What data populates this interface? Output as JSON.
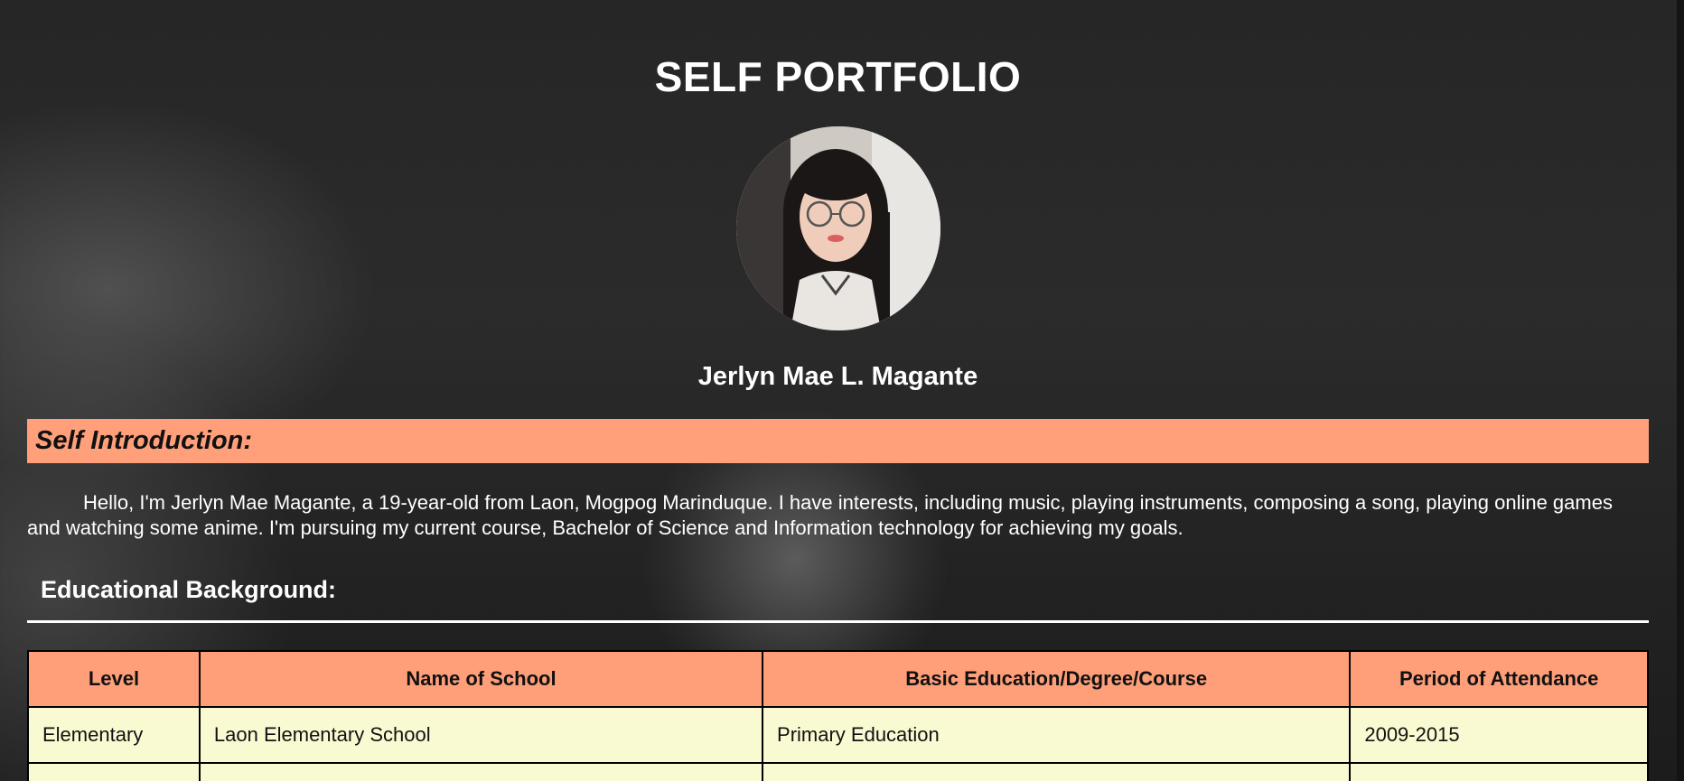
{
  "header": {
    "title": "SELF PORTFOLIO"
  },
  "profile": {
    "photo_icon": "profile-photo",
    "name": "Jerlyn Mae L. Magante"
  },
  "introduction": {
    "heading": "Self Introduction:",
    "body": "Hello, I'm Jerlyn Mae Magante, a 19-year-old from Laon, Mogpog Marinduque. I have interests, including music, playing instruments, composing a song, playing online games and watching some anime. I'm pursuing my current course, Bachelor of Science and Information technology for achieving my goals."
  },
  "education": {
    "heading": "Educational Background:",
    "columns": [
      "Level",
      "Name of School",
      "Basic Education/Degree/Course",
      "Period of Attendance"
    ],
    "rows": [
      [
        "Elementary",
        "Laon Elementary School",
        "Primary Education",
        "2009-2015"
      ],
      [
        "",
        "",
        "",
        ""
      ]
    ]
  },
  "colors": {
    "banner": "#ffa07a",
    "table_header": "#ff9f7a",
    "table_cell": "#fafad2"
  }
}
